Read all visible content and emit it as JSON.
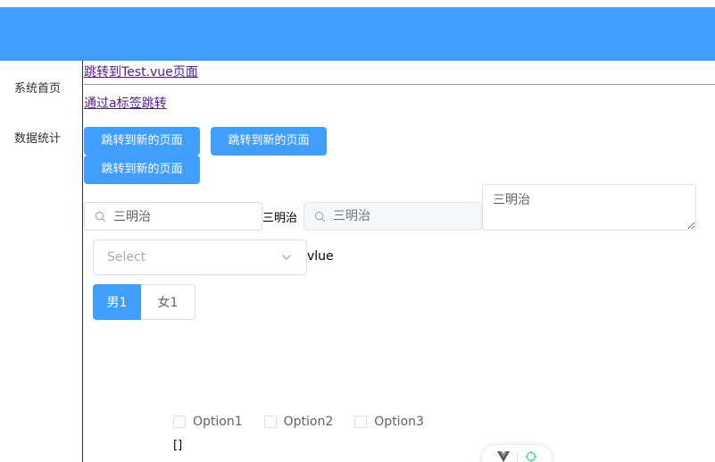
{
  "colors": {
    "primary": "#409eff",
    "link_visited": "#551a8b",
    "border": "#dcdfe6",
    "placeholder": "#a8abb2"
  },
  "sidebar": {
    "items": [
      {
        "label": "系统首页"
      },
      {
        "label": "数据统计"
      }
    ]
  },
  "main": {
    "links": {
      "router_link": "跳转到Test.vue页面",
      "a_link": "通过a标签跳转"
    },
    "buttons": {
      "b1": "跳转到新的页面",
      "b2": "跳转到新的页面",
      "b3": "跳转到新的页面"
    },
    "inputs": {
      "search_value": "三明治",
      "echo": "三明治",
      "disabled_placeholder": "三明治",
      "textarea_value": "三明治",
      "search_icon": "search-icon"
    },
    "select": {
      "placeholder": "Select",
      "after_text": "vlue",
      "icon": "chevron-down-icon"
    },
    "radio": {
      "active": "男1",
      "inactive": "女1"
    },
    "checkboxes": {
      "options": [
        "Option1",
        "Option2",
        "Option3"
      ],
      "value_text": "[]"
    }
  }
}
